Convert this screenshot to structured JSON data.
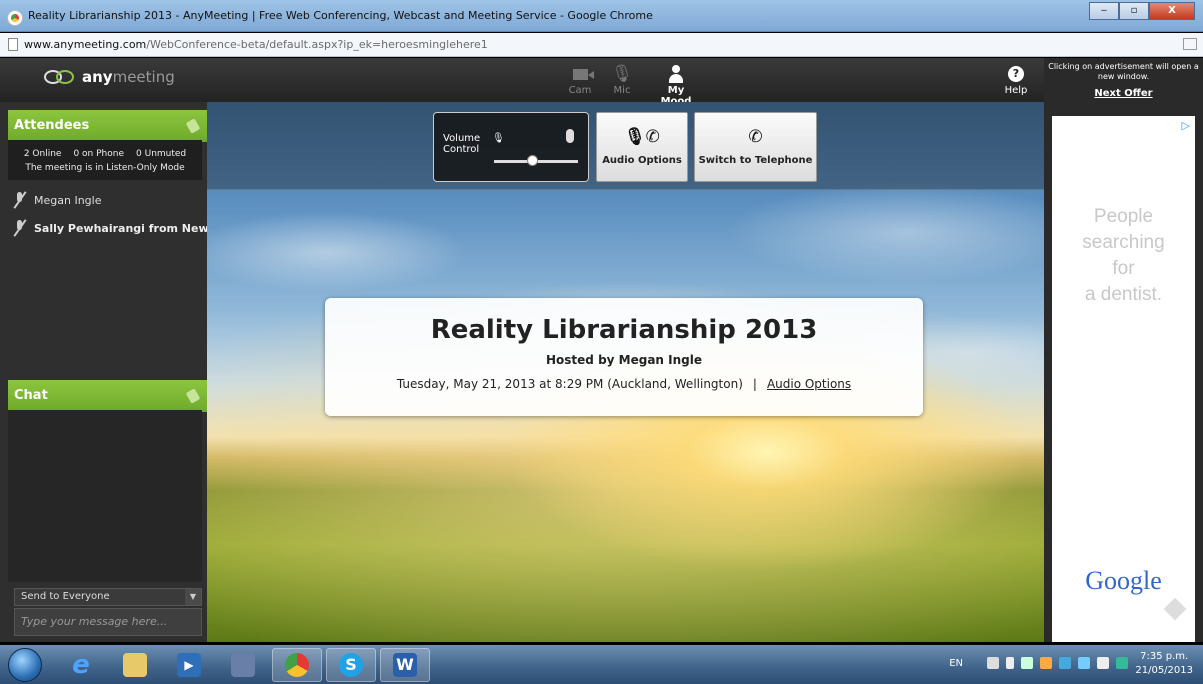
{
  "window": {
    "title": "Reality Librarianship 2013 - AnyMeeting | Free Web Conferencing, Webcast and Meeting Service - Google Chrome",
    "url_host": "www.anymeeting.com",
    "url_path": "/WebConference-beta/default.aspx?ip_ek=heroesminglehere1",
    "buttons": {
      "minimize": "‒",
      "maximize": "▫",
      "close": "X"
    }
  },
  "app": {
    "logo_bold": "any",
    "logo_light": "meeting",
    "top_buttons": [
      {
        "label": "Cam",
        "icon": "camera-icon",
        "state": "disabled"
      },
      {
        "label": "Mic",
        "icon": "mic-muted-icon",
        "state": "disabled"
      },
      {
        "label": "My Mood",
        "icon": "person-icon",
        "state": "enabled"
      },
      {
        "label": "Help",
        "icon": "help-icon",
        "state": "enabled"
      }
    ]
  },
  "sidebar": {
    "attendees_title": "Attendees",
    "stats": {
      "online": "2 Online",
      "phone": "0 on Phone",
      "unmuted": "0 Unmuted",
      "mode": "The meeting is in Listen-Only Mode"
    },
    "attendees": [
      {
        "name": "Megan Ingle"
      },
      {
        "name": "Sally Pewhairangi from New ..."
      }
    ],
    "chat_title": "Chat",
    "send_to": "Send to Everyone",
    "message_placeholder": "Type your message here..."
  },
  "stage": {
    "volume_label_line1": "Volume",
    "volume_label_line2": "Control",
    "volume_level": 0.45,
    "audio_options_label": "Audio Options",
    "switch_telephone_label": "Switch to Telephone",
    "meeting_title": "Reality Librarianship 2013",
    "hosted_by": "Hosted by Megan Ingle",
    "datetime": "Tuesday, May 21, 2013 at 8:29 PM (Auckland, Wellington)",
    "separator": "|",
    "audio_options_link": "Audio Options"
  },
  "ad": {
    "notice": "Clicking on advertisement will open a new window.",
    "next_offer": "Next Offer",
    "text_lines": [
      "People",
      "searching",
      "for",
      "a dentist."
    ],
    "brand": "Google"
  },
  "taskbar": {
    "apps": [
      "internet-explorer",
      "file-explorer",
      "media-player",
      "windows-live",
      "chrome",
      "skype",
      "word"
    ],
    "language": "EN",
    "time": "7:35 p.m.",
    "date": "21/05/2013"
  },
  "colors": {
    "accent_green": "#8cc63f",
    "app_dark": "#2f2f2f",
    "link_blue": "#3366cc"
  }
}
